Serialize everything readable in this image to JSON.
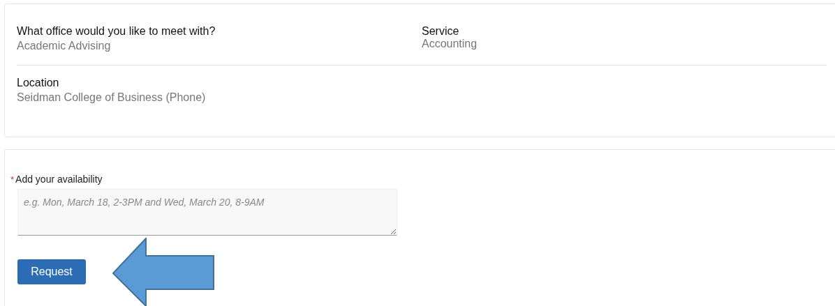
{
  "summary": {
    "fields": [
      {
        "label": "What office would you like to meet with?",
        "value": "Academic Advising"
      },
      {
        "label": "Service",
        "value": "Accounting"
      },
      {
        "label": "Location",
        "value": "Seidman College of Business (Phone)"
      }
    ]
  },
  "availability": {
    "required_mark": "*",
    "label": "Add your availability",
    "placeholder": "e.g. Mon, March 18, 2-3PM and Wed, March 20, 8-9AM"
  },
  "buttons": [
    "Request"
  ]
}
